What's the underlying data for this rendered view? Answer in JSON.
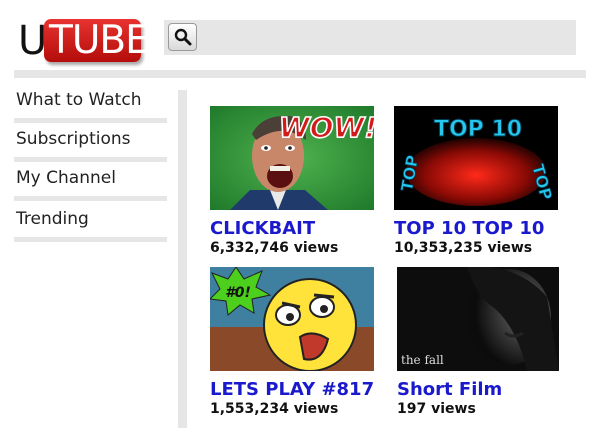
{
  "header": {
    "logo_prefix": "U",
    "logo_text": "TUBE",
    "search_icon": "magnifier-icon",
    "search_placeholder": ""
  },
  "sidebar": {
    "items": [
      {
        "label": "What to Watch"
      },
      {
        "label": "Subscriptions"
      },
      {
        "label": "My Channel"
      },
      {
        "label": "Trending"
      }
    ]
  },
  "videos": [
    {
      "title": "CLICKBAIT",
      "views": "6,332,746 views",
      "thumb_text": "WOW!"
    },
    {
      "title": "TOP 10 TOP 10",
      "views": "10,353,235 views",
      "thumb_text": "TOP 10"
    },
    {
      "title": "LETS PLAY #817",
      "views": "1,553,234 views",
      "thumb_text": "#0!"
    },
    {
      "title": "Short Film",
      "views": "197 views",
      "thumb_caption": "the fall"
    }
  ],
  "colors": {
    "brand_red": "#c91a17",
    "link_blue": "#1a1acc",
    "panel_gray": "#e6e6e6"
  }
}
